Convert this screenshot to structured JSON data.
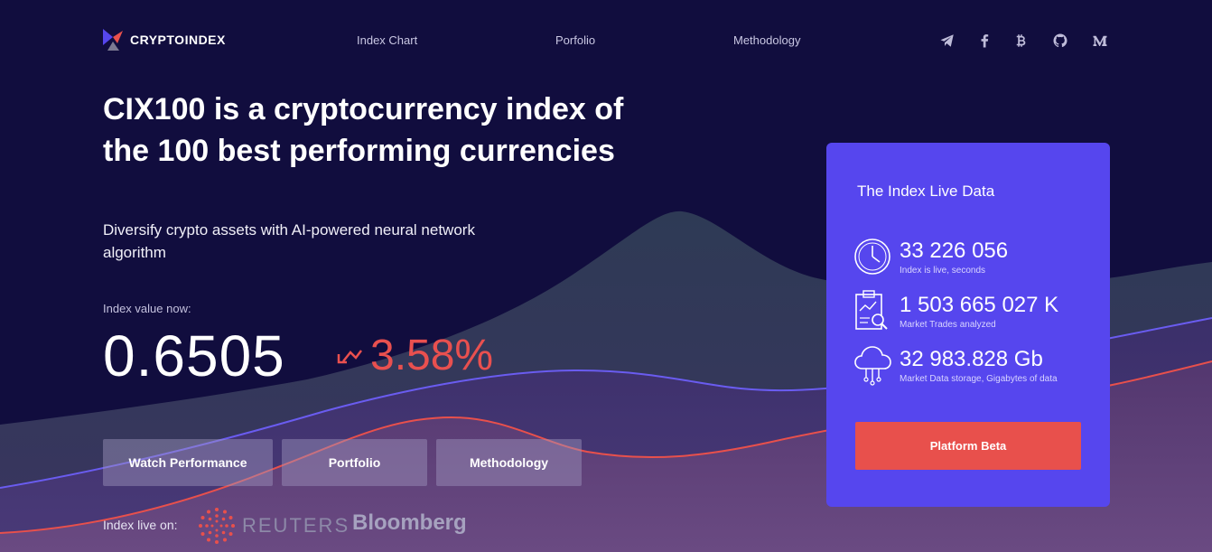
{
  "brand": {
    "name": "CRYPTOINDEX",
    "icon": "cryptoindex-logo-icon"
  },
  "nav": {
    "links": [
      "Index Chart",
      "Porfolio",
      "Methodology"
    ],
    "social_icons": [
      "telegram-icon",
      "facebook-icon",
      "bitcoin-icon",
      "github-icon",
      "medium-icon"
    ]
  },
  "hero": {
    "title": "CIX100 is a cryptocurrency index of the 100 best performing currencies",
    "subtitle": "Diversify crypto assets with AI-powered neural network algorithm",
    "index_label": "Index value now:",
    "index_value": "0.6505",
    "change": "3.58%",
    "change_icon": "trend-down-arrow-icon"
  },
  "buttons": [
    "Watch Performance",
    "Portfolio",
    "Methodology"
  ],
  "press": {
    "label": "Index live on:",
    "reuters": "REUTERS",
    "bloomberg": "Bloomberg"
  },
  "live_card": {
    "title": "The Index Live Data",
    "stats": [
      {
        "value": "33 226 056",
        "label": "Index is live, seconds",
        "icon": "clock-icon"
      },
      {
        "value": "1 503 665 027 K",
        "label": "Market Trades analyzed",
        "icon": "clipboard-chart-icon"
      },
      {
        "value": "32 983.828 Gb",
        "label": "Market Data storage, Gigabytes of data",
        "icon": "cloud-data-icon"
      }
    ],
    "cta": "Platform Beta"
  },
  "colors": {
    "background": "#110d3e",
    "card": "#5646ee",
    "accent_red": "#e8504c",
    "mountain": "#2d3554",
    "line_blue": "#6a5cf0",
    "line_red": "#e8504c"
  }
}
